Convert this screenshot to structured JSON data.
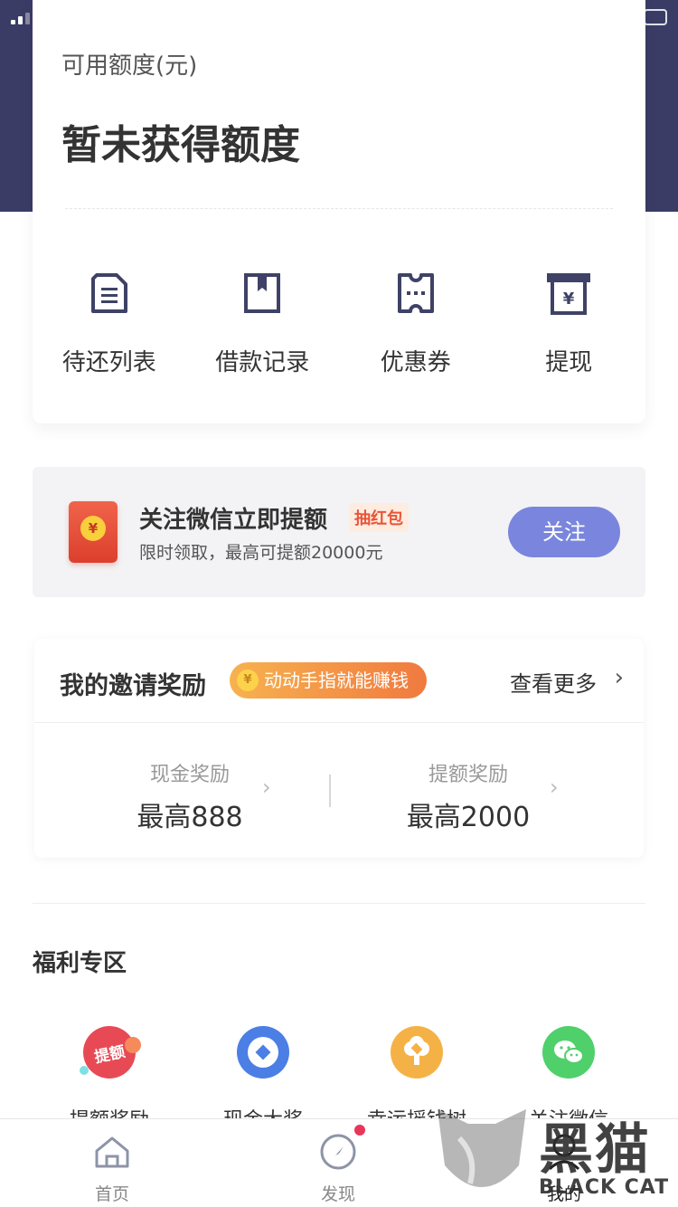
{
  "colors": {
    "header_bg": "#3a3c66",
    "accent": "#7a85de",
    "tag_orange": "#e8553a",
    "badge_red": "#e8365a"
  },
  "quota": {
    "label": "可用额度(元)",
    "value": "暂未获得额度"
  },
  "actions": [
    {
      "label": "待还列表",
      "icon": "list-doc-icon"
    },
    {
      "label": "借款记录",
      "icon": "bookmark-book-icon"
    },
    {
      "label": "优惠券",
      "icon": "coupon-ticket-icon"
    },
    {
      "label": "提现",
      "icon": "yuan-withdraw-icon"
    }
  ],
  "follow_banner": {
    "title": "关注微信立即提额",
    "tag": "抽红包",
    "subtitle": "限时领取，最高可提额20000元",
    "button": "关注",
    "icon": "red-envelope-icon",
    "coin_symbol": "¥"
  },
  "invite": {
    "title": "我的邀请奖励",
    "tag": "动动手指就能赚钱",
    "more": "查看更多",
    "coin_symbol": "¥",
    "rewards": [
      {
        "label": "现金奖励",
        "value": "最高888"
      },
      {
        "label": "提额奖励",
        "value": "最高2000"
      }
    ]
  },
  "welfare": {
    "title": "福利专区",
    "items": [
      {
        "label": "提额奖励",
        "icon": "raise-limit-badge-icon",
        "badge_text": "提额"
      },
      {
        "label": "现金大奖",
        "icon": "cash-coin-icon"
      },
      {
        "label": "幸运摇钱树",
        "icon": "money-tree-icon"
      },
      {
        "label": "关注微信",
        "icon": "wechat-icon"
      }
    ]
  },
  "tabbar": [
    {
      "label": "首页",
      "icon": "home-icon"
    },
    {
      "label": "发现",
      "icon": "compass-icon",
      "has_dot": true
    },
    {
      "label": "我的",
      "icon": "user-icon"
    }
  ],
  "watermark": {
    "text": "黑猫",
    "sub": "BLACK CAT"
  }
}
